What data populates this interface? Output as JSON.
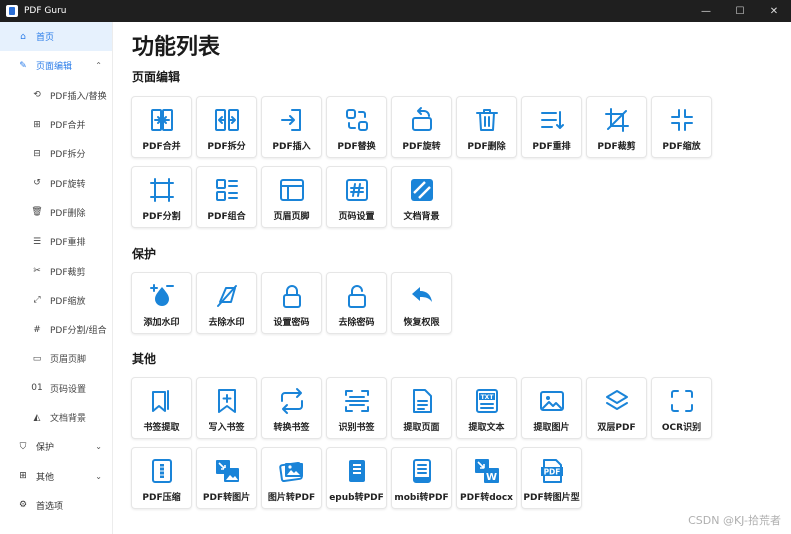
{
  "window": {
    "title": "PDF Guru",
    "controls": [
      "—",
      "☐",
      "✕"
    ]
  },
  "sidebar": {
    "items": [
      {
        "label": "首页",
        "icon": "home-icon",
        "glyph": "⌂",
        "level": "top",
        "state": "active"
      },
      {
        "label": "页面编辑",
        "icon": "edit-icon",
        "glyph": "✎",
        "level": "top",
        "state": "expanded",
        "chevron": "^"
      },
      {
        "label": "PDF插入/替换",
        "icon": "insert-replace-icon",
        "glyph": "⟲",
        "level": "sub"
      },
      {
        "label": "PDF合并",
        "icon": "merge-icon",
        "glyph": "⊞",
        "level": "sub"
      },
      {
        "label": "PDF拆分",
        "icon": "split-icon",
        "glyph": "⊟",
        "level": "sub"
      },
      {
        "label": "PDF旋转",
        "icon": "rotate-icon",
        "glyph": "↺",
        "level": "sub"
      },
      {
        "label": "PDF删除",
        "icon": "trash-icon",
        "glyph": "🗑",
        "level": "sub"
      },
      {
        "label": "PDF重排",
        "icon": "reorder-icon",
        "glyph": "☰",
        "level": "sub"
      },
      {
        "label": "PDF裁剪",
        "icon": "scissors-icon",
        "glyph": "✂",
        "level": "sub"
      },
      {
        "label": "PDF缩放",
        "icon": "zoom-icon",
        "glyph": "⤢",
        "level": "sub"
      },
      {
        "label": "PDF分割/组合",
        "icon": "hash-icon",
        "glyph": "#",
        "level": "sub"
      },
      {
        "label": "页眉页脚",
        "icon": "header-footer-icon",
        "glyph": "▭",
        "level": "sub"
      },
      {
        "label": "页码设置",
        "icon": "page-number-icon",
        "glyph": "01",
        "level": "sub"
      },
      {
        "label": "文档背景",
        "icon": "background-icon",
        "glyph": "◭",
        "level": "sub"
      },
      {
        "label": "保护",
        "icon": "shield-icon",
        "glyph": "⛉",
        "level": "top",
        "chevron": "v"
      },
      {
        "label": "其他",
        "icon": "grid-icon",
        "glyph": "⊞",
        "level": "top",
        "chevron": "v"
      },
      {
        "label": "首选项",
        "icon": "gear-icon",
        "glyph": "⚙",
        "level": "top"
      }
    ]
  },
  "main": {
    "title": "功能列表",
    "sections": [
      {
        "title": "页面编辑",
        "tools": [
          {
            "label": "PDF合并",
            "icon": "merge-icon"
          },
          {
            "label": "PDF拆分",
            "icon": "split-icon"
          },
          {
            "label": "PDF插入",
            "icon": "insert-icon"
          },
          {
            "label": "PDF替换",
            "icon": "replace-icon"
          },
          {
            "label": "PDF旋转",
            "icon": "rotate-icon"
          },
          {
            "label": "PDF删除",
            "icon": "trash-icon"
          },
          {
            "label": "PDF重排",
            "icon": "reorder-icon"
          },
          {
            "label": "PDF裁剪",
            "icon": "crop-icon"
          },
          {
            "label": "PDF缩放",
            "icon": "zoom-icon"
          },
          {
            "label": "PDF分割",
            "icon": "divide-icon"
          },
          {
            "label": "PDF组合",
            "icon": "combine-icon"
          },
          {
            "label": "页眉页脚",
            "icon": "header-footer-icon"
          },
          {
            "label": "页码设置",
            "icon": "page-number-icon"
          },
          {
            "label": "文档背景",
            "icon": "background-icon"
          }
        ]
      },
      {
        "title": "保护",
        "tools": [
          {
            "label": "添加水印",
            "icon": "watermark-add-icon"
          },
          {
            "label": "去除水印",
            "icon": "watermark-remove-icon"
          },
          {
            "label": "设置密码",
            "icon": "lock-icon"
          },
          {
            "label": "去除密码",
            "icon": "unlock-icon"
          },
          {
            "label": "恢复权限",
            "icon": "restore-icon"
          }
        ]
      },
      {
        "title": "其他",
        "tools": [
          {
            "label": "书签提取",
            "icon": "bookmark-extract-icon"
          },
          {
            "label": "写入书签",
            "icon": "bookmark-add-icon"
          },
          {
            "label": "转换书签",
            "icon": "convert-icon"
          },
          {
            "label": "识别书签",
            "icon": "scan-bookmark-icon"
          },
          {
            "label": "提取页面",
            "icon": "extract-page-icon"
          },
          {
            "label": "提取文本",
            "icon": "extract-text-icon",
            "badge": "TXT"
          },
          {
            "label": "提取图片",
            "icon": "extract-image-icon"
          },
          {
            "label": "双层PDF",
            "icon": "layers-icon"
          },
          {
            "label": "OCR识别",
            "icon": "ocr-icon"
          },
          {
            "label": "PDF压缩",
            "icon": "compress-icon"
          },
          {
            "label": "PDF转图片",
            "icon": "pdf-to-image-icon"
          },
          {
            "label": "图片转PDF",
            "icon": "image-to-pdf-icon"
          },
          {
            "label": "epub转PDF",
            "icon": "epub-to-pdf-icon"
          },
          {
            "label": "mobi转PDF",
            "icon": "mobi-to-pdf-icon"
          },
          {
            "label": "PDF转docx",
            "icon": "pdf-to-docx-icon",
            "badge": "W"
          },
          {
            "label": "PDF转图片型",
            "icon": "pdf-to-imagepdf-icon",
            "badge": "PDF"
          }
        ]
      }
    ]
  },
  "watermark": "CSDN @KJ-拾荒者",
  "colors": {
    "accent": "#2b7de9",
    "icon": "#1a84d8",
    "active_bg": "#e6f1fd",
    "titlebar": "#1f1f1f"
  }
}
